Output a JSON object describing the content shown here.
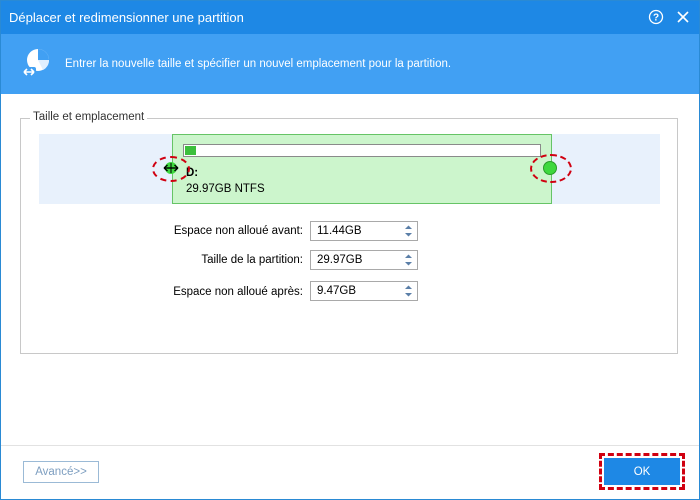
{
  "window": {
    "title": "Déplacer et redimensionner une partition",
    "help_label": "?",
    "close_label": "✕"
  },
  "header": {
    "instruction": "Entrer la nouvelle taille et spécifier un nouvel emplacement pour la partition.",
    "icon": "partition-resize-icon"
  },
  "group": {
    "legend": "Taille et emplacement"
  },
  "partition": {
    "drive_letter": "D:",
    "info": "29.97GB NTFS",
    "used_fraction": 0.03
  },
  "fields": [
    {
      "label": "Espace non alloué avant:",
      "value": "11.44GB"
    },
    {
      "label": "Taille de la partition:",
      "value": "29.97GB"
    },
    {
      "label": "Espace non alloué après:",
      "value": "9.47GB"
    }
  ],
  "footer": {
    "advanced_label": "Avancé>>",
    "ok_label": "OK"
  },
  "colors": {
    "title_bar": "#1e88e5",
    "header_band": "#41a0f3",
    "partition_fill": "#ccf5cc",
    "highlight": "#d00010"
  }
}
